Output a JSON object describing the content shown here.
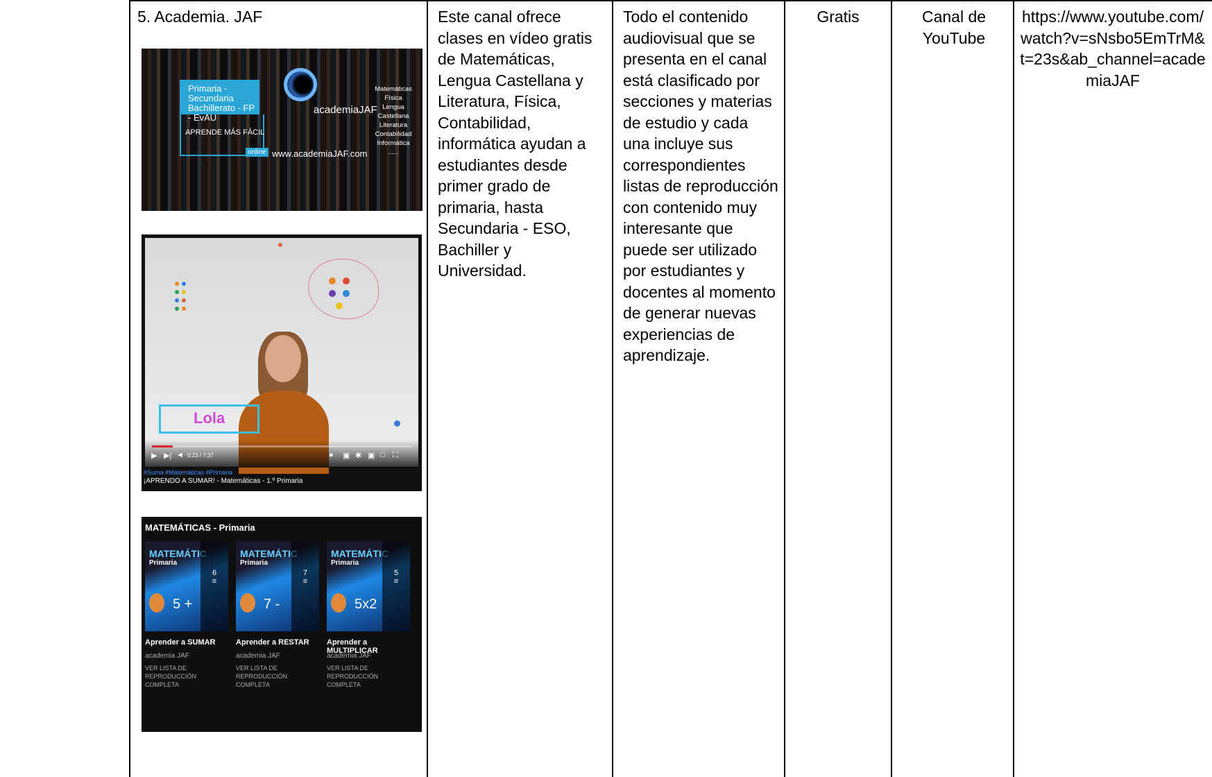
{
  "row": {
    "title": "5. Academia. JAF",
    "description": "Este canal ofrece clases en vídeo gratis de Matemáticas, Lengua Castellana y Literatura, Física, Contabilidad, informática ayudan a estudiantes desde primer grado de primaria, hasta Secundaria - ESO, Bachiller y Universidad.",
    "contenido": "Todo el contenido audiovisual que se presenta en el canal está clasificado por secciones y materias de estudio y cada una incluye sus correspondientes listas de reproducción con contenido muy interesante que puede ser utilizado por estudiantes y docentes al momento de generar nuevas experiencias de aprendizaje.",
    "costo": "Gratis",
    "tipo": "Canal de YouTube",
    "url": "https://www.youtube.com/watch?v=sNsbo5EmTrM&t=23s&ab_channel=academiaJAF"
  },
  "thumb1": {
    "levels_line1": "Primaria - Secundaria",
    "levels_line2": "Bachillerato - FP - EvAU",
    "slogan": "APRENDE MÁS FÁCIL",
    "online": "online",
    "brand": "academiaJAF",
    "website": "www.academiaJAF.com",
    "subjects": [
      "Matemáticas",
      "Física",
      "Lengua Castellana",
      "Literatura",
      "Contabilidad",
      "Informática",
      "......"
    ]
  },
  "thumb2": {
    "name_label": "Lola",
    "time": "0:23 / 7:37",
    "hashtags": "#Suma #Matemáticas #Primaria",
    "video_title": "¡APRENDO A SUMAR! - Matemáticas - 1.º Primaria"
  },
  "thumb3": {
    "header": "MATEMÁTICAS - Primaria",
    "cards": [
      {
        "heading": "MATEMÁTIC",
        "sub": "Primaria",
        "op": "5 +",
        "count": "6",
        "title": "Aprender a SUMAR",
        "channel": "academia JAF",
        "link": "VER LISTA DE REPRODUCCIÓN COMPLETA"
      },
      {
        "heading": "MATEMÁTIC",
        "sub": "Primaria",
        "op": "7 -",
        "count": "7",
        "title": "Aprender a RESTAR",
        "channel": "academia JAF",
        "link": "VER LISTA DE REPRODUCCIÓN COMPLETA"
      },
      {
        "heading": "MATEMÁTIC",
        "sub": "Primaria",
        "op": "5x2",
        "count": "5",
        "title": "Aprender a MULTIPLICAR",
        "channel": "academia JAF",
        "link": "VER LISTA DE REPRODUCCIÓN COMPLETA"
      }
    ]
  }
}
